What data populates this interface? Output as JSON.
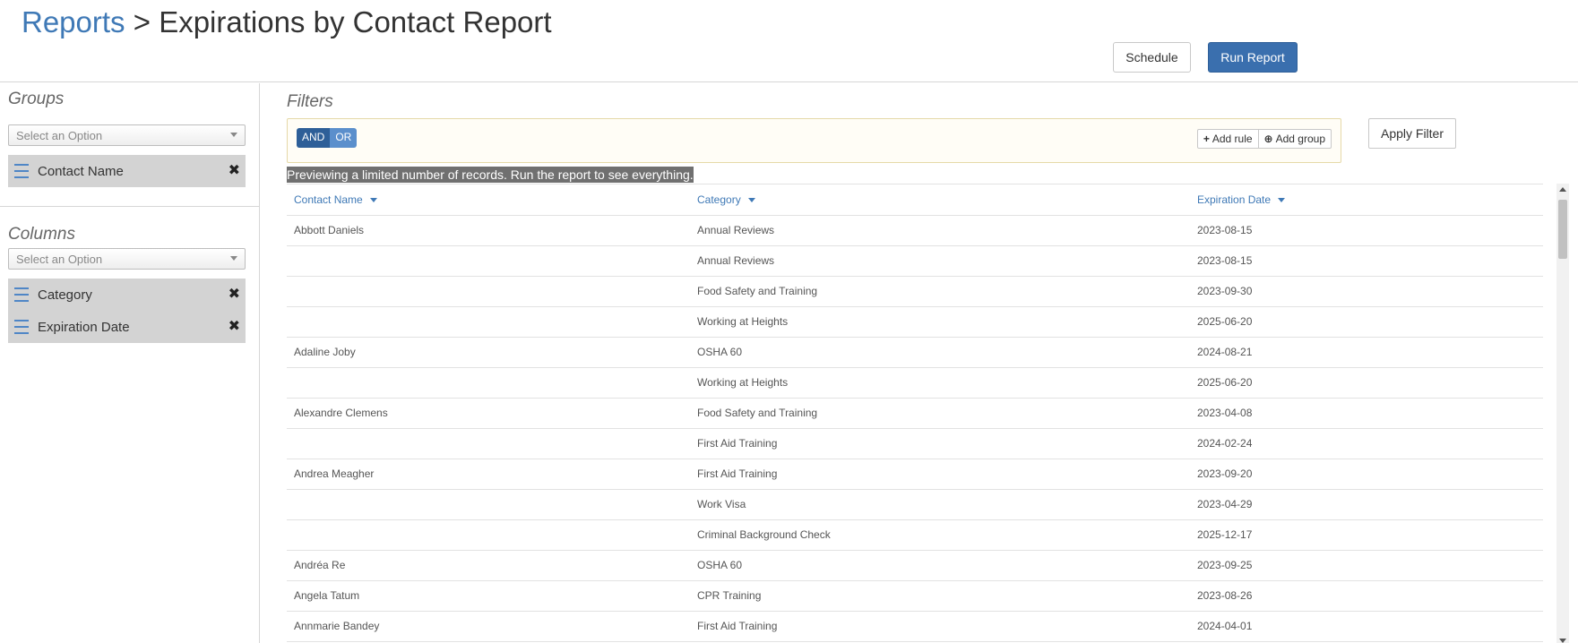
{
  "header": {
    "breadcrumb_link": "Reports",
    "breadcrumb_separator": ">",
    "title": "Expirations by Contact Report",
    "schedule_label": "Schedule",
    "run_report_label": "Run Report"
  },
  "groups": {
    "title": "Groups",
    "select_placeholder": "Select an Option",
    "items": [
      {
        "label": "Contact Name"
      }
    ]
  },
  "columns_panel": {
    "title": "Columns",
    "select_placeholder": "Select an Option",
    "items": [
      {
        "label": "Category"
      },
      {
        "label": "Expiration Date"
      }
    ]
  },
  "filters": {
    "title": "Filters",
    "and_label": "AND",
    "or_label": "OR",
    "add_rule_label": "Add rule",
    "add_group_label": "Add group",
    "apply_label": "Apply Filter"
  },
  "preview_note": "Previewing a limited number of records. Run the report to see everything.",
  "table": {
    "headers": [
      "Contact Name",
      "Category",
      "Expiration Date"
    ],
    "rows": [
      [
        "Abbott Daniels",
        "Annual Reviews",
        "2023-08-15"
      ],
      [
        "",
        "Annual Reviews",
        "2023-08-15"
      ],
      [
        "",
        "Food Safety and Training",
        "2023-09-30"
      ],
      [
        "",
        "Working at Heights",
        "2025-06-20"
      ],
      [
        "Adaline Joby",
        "OSHA 60",
        "2024-08-21"
      ],
      [
        "",
        "Working at Heights",
        "2025-06-20"
      ],
      [
        "Alexandre Clemens",
        "Food Safety and Training",
        "2023-04-08"
      ],
      [
        "",
        "First Aid Training",
        "2024-02-24"
      ],
      [
        "Andrea Meagher",
        "First Aid Training",
        "2023-09-20"
      ],
      [
        "",
        "Work Visa",
        "2023-04-29"
      ],
      [
        "",
        "Criminal Background Check",
        "2025-12-17"
      ],
      [
        "Andréa Re",
        "OSHA 60",
        "2023-09-25"
      ],
      [
        "Angela Tatum",
        "CPR Training",
        "2023-08-26"
      ],
      [
        "Annmarie Bandey",
        "First Aid Training",
        "2024-04-01"
      ]
    ]
  },
  "colors": {
    "accent": "#3f79b6",
    "primary_button": "#3a6fae",
    "pill_background": "#d3d3d3"
  }
}
